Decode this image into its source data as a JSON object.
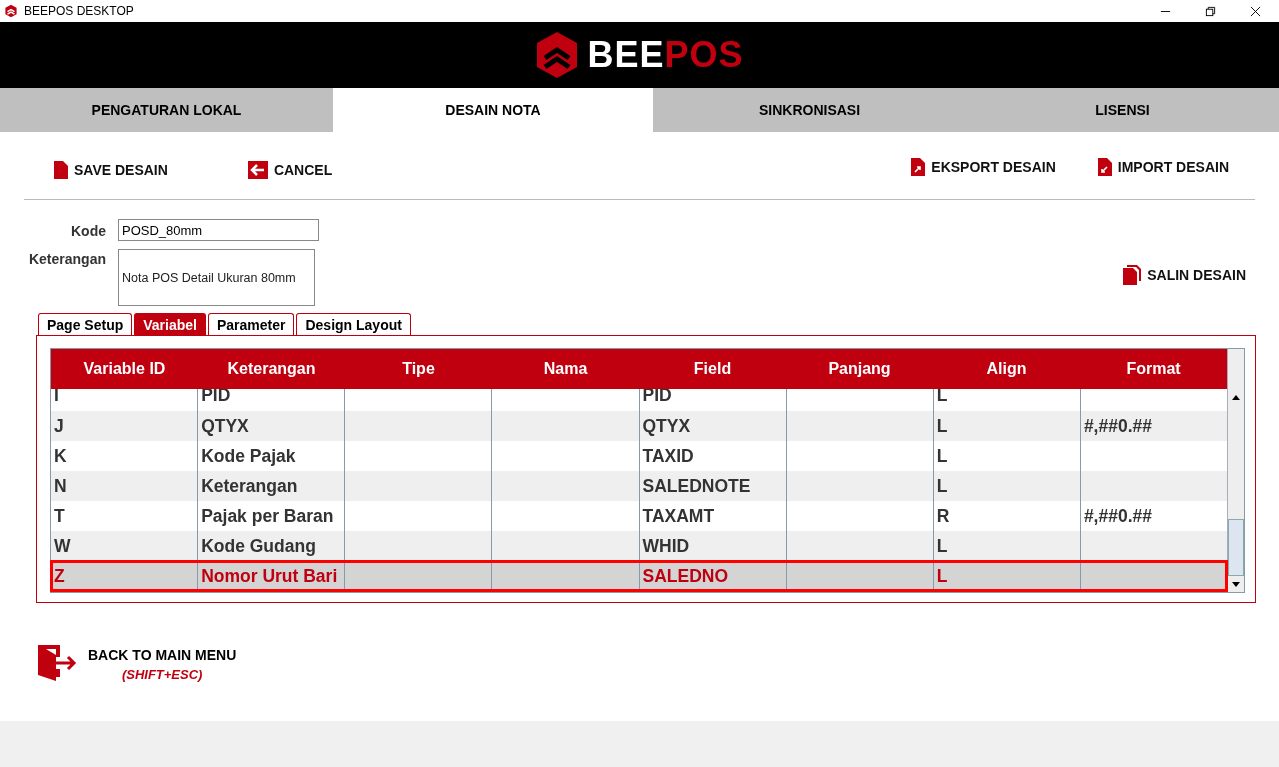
{
  "window": {
    "title": "BEEPOS DESKTOP"
  },
  "logo": {
    "part_1": "BEE",
    "part_2": "POS"
  },
  "tabs": [
    {
      "label": "PENGATURAN LOKAL",
      "selected": false
    },
    {
      "label": "DESAIN NOTA",
      "selected": true
    },
    {
      "label": "SINKRONISASI",
      "selected": false
    },
    {
      "label": "LISENSI",
      "selected": false
    }
  ],
  "toolbar": {
    "left": [
      {
        "label": "SAVE DESAIN",
        "kind": "file"
      },
      {
        "label": "CANCEL",
        "kind": "back"
      }
    ],
    "right": [
      {
        "label": "EKSPORT DESAIN",
        "kind": "export"
      },
      {
        "label": "IMPORT DESAIN",
        "kind": "import"
      }
    ]
  },
  "form": {
    "code_label": "Kode",
    "code_value": "POSD_80mm",
    "desc_label": "Keterangan",
    "desc_value": "Nota POS Detail Ukuran 80mm"
  },
  "copy_button": "SALIN DESAIN",
  "inner_tabs": [
    {
      "label": "Page Setup",
      "selected": false
    },
    {
      "label": "Variabel",
      "selected": true
    },
    {
      "label": "Parameter",
      "selected": false
    },
    {
      "label": "Design Layout",
      "selected": false
    }
  ],
  "table": {
    "columns": [
      "Variable ID",
      "Keterangan",
      "Tipe",
      "Nama",
      "Field",
      "Panjang",
      "Align",
      "Format"
    ],
    "rows": [
      {
        "cells": [
          "I",
          "PID",
          "",
          "",
          "PID",
          "",
          "L",
          ""
        ],
        "selected": false
      },
      {
        "cells": [
          "J",
          "QTYX",
          "",
          "",
          "QTYX",
          "",
          "L",
          "#,##0.##"
        ],
        "selected": false
      },
      {
        "cells": [
          "K",
          "Kode Pajak",
          "",
          "",
          "TAXID",
          "",
          "L",
          ""
        ],
        "selected": false
      },
      {
        "cells": [
          "N",
          "Keterangan",
          "",
          "",
          "SALEDNOTE",
          "",
          "L",
          ""
        ],
        "selected": false
      },
      {
        "cells": [
          "T",
          "Pajak per Baran",
          "",
          "",
          "TAXAMT",
          "",
          "R",
          "#,##0.##"
        ],
        "selected": false
      },
      {
        "cells": [
          "W",
          "Kode Gudang",
          "",
          "",
          "WHID",
          "",
          "L",
          ""
        ],
        "selected": false
      },
      {
        "cells": [
          "Z",
          "Nomor Urut Bari",
          "",
          "",
          "SALEDNO",
          "",
          "L",
          ""
        ],
        "selected": true
      }
    ]
  },
  "back": {
    "label": "BACK TO MAIN MENU",
    "shortcut": "(SHIFT+ESC)"
  }
}
